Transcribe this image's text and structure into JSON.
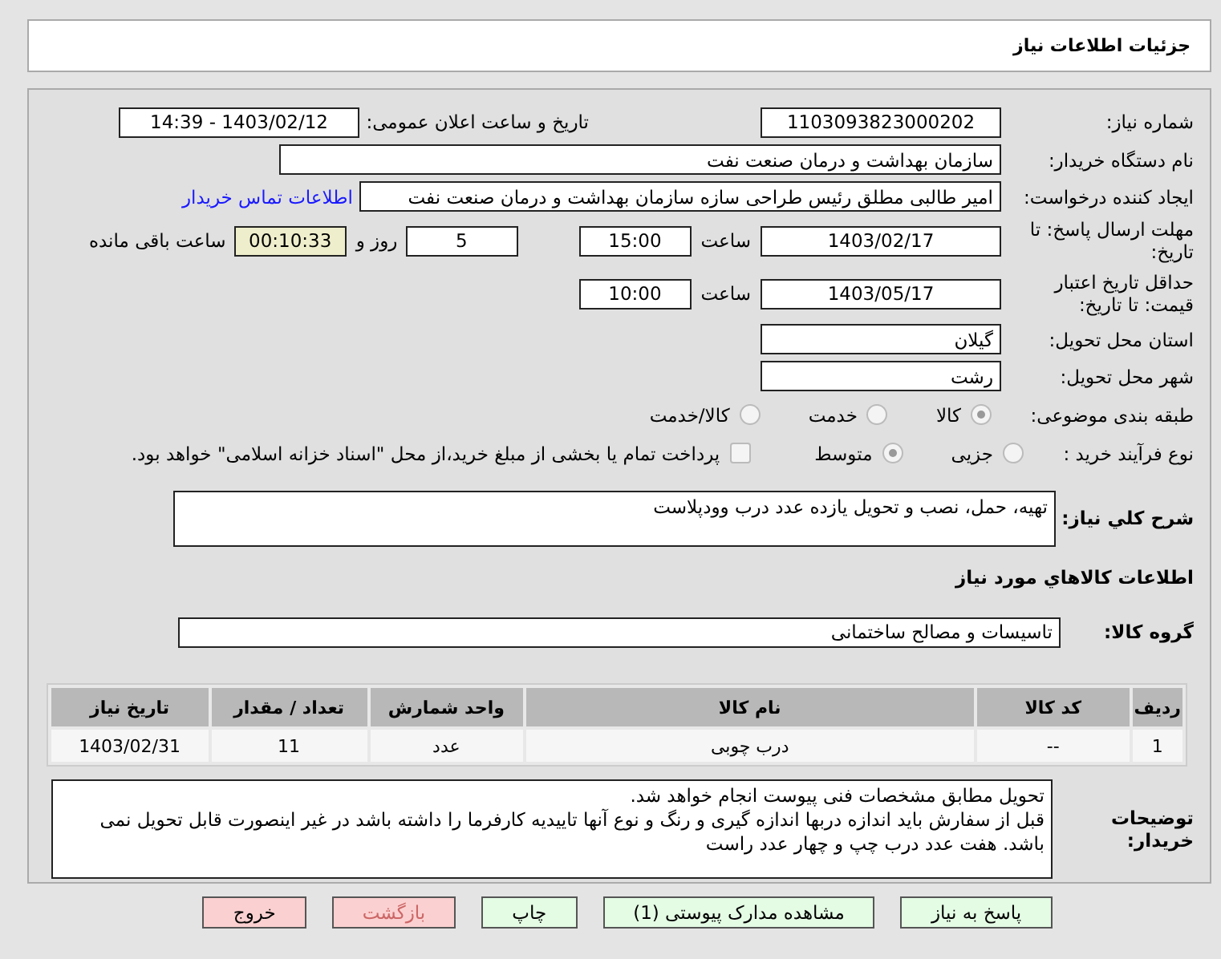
{
  "header": {
    "title": "جزئیات اطلاعات نیاز"
  },
  "need_number": {
    "label": "شماره نیاز:",
    "value": "1103093823000202"
  },
  "announce": {
    "label": "تاریخ و ساعت اعلان عمومی:",
    "value": "1403/02/12 - 14:39"
  },
  "buyer": {
    "label": "نام دستگاه خریدار:",
    "value": "سازمان بهداشت و درمان صنعت نفت"
  },
  "creator": {
    "label": "ایجاد کننده درخواست:",
    "value": "امیر طالبی مطلق رئیس طراحی سازه سازمان بهداشت و درمان صنعت نفت",
    "link": "اطلاعات تماس خریدار"
  },
  "deadline": {
    "label": "مهلت ارسال پاسخ: تا تاریخ:",
    "date": "1403/02/17",
    "time_label": "ساعت",
    "time": "15:00",
    "days": "5",
    "days_label": "روز و",
    "remaining": "00:10:33",
    "remaining_label": "ساعت باقی مانده"
  },
  "validity": {
    "label": "حداقل تاریخ اعتبار قیمت: تا تاریخ:",
    "date": "1403/05/17",
    "time_label": "ساعت",
    "time": "10:00"
  },
  "province": {
    "label": "استان محل تحویل:",
    "value": "گیلان"
  },
  "city": {
    "label": "شهر محل تحویل:",
    "value": "رشت"
  },
  "category": {
    "label": "طبقه بندی موضوعی:",
    "options": [
      {
        "label": "کالا",
        "selected": true
      },
      {
        "label": "خدمت",
        "selected": false
      },
      {
        "label": "کالا/خدمت",
        "selected": false
      }
    ]
  },
  "process": {
    "label": "نوع فرآیند خرید :",
    "options": [
      {
        "label": "جزیی",
        "selected": false
      },
      {
        "label": "متوسط",
        "selected": true
      }
    ],
    "treasury": {
      "checked": false,
      "label": "پرداخت تمام یا بخشی از مبلغ خرید،از محل \"اسناد خزانه اسلامی\" خواهد بود."
    }
  },
  "description": {
    "label": "شرح کلي نیاز:",
    "value": "تهیه، حمل، نصب و تحویل یازده عدد درب وودپلاست"
  },
  "goods_heading": "اطلاعات کالاهاي مورد نیاز",
  "goods_group": {
    "label": "گروه کالا:",
    "value": "تاسیسات و مصالح ساختمانی"
  },
  "table": {
    "columns": [
      "ردیف",
      "کد کالا",
      "نام کالا",
      "واحد شمارش",
      "تعداد / مقدار",
      "تاریخ نیاز"
    ],
    "rows": [
      [
        "1",
        "--",
        "درب چوبی",
        "عدد",
        "11",
        "1403/02/31"
      ]
    ]
  },
  "notes": {
    "label": "توضیحات خریدار:",
    "value": "تحویل مطابق مشخصات فنی پیوست انجام خواهد شد.\nقبل از سفارش باید اندازه دربها اندازه گیری و رنگ و نوع آنها تاییدیه کارفرما را داشته باشد در غیر اینصورت قابل تحویل نمی باشد. هفت عدد درب چپ و چهار عدد راست"
  },
  "buttons": [
    {
      "label": "پاسخ به نیاز",
      "kind": "action"
    },
    {
      "label": "مشاهده مدارک پیوستی (1)",
      "kind": "action"
    },
    {
      "label": "چاپ",
      "kind": "action"
    },
    {
      "label": "بازگشت",
      "kind": "back"
    },
    {
      "label": "خروج",
      "kind": "exit"
    }
  ]
}
